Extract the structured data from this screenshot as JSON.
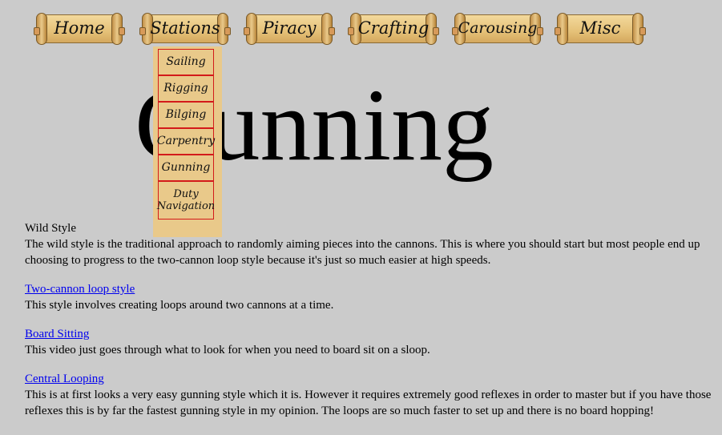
{
  "nav": {
    "tabs": [
      {
        "label": "Home"
      },
      {
        "label": "Stations"
      },
      {
        "label": "Piracy"
      },
      {
        "label": "Crafting"
      },
      {
        "label": "Carousing"
      },
      {
        "label": "Misc"
      }
    ],
    "dropdown": [
      {
        "label": "Sailing"
      },
      {
        "label": "Rigging"
      },
      {
        "label": "Bilging"
      },
      {
        "label": "Carpentry"
      },
      {
        "label": "Gunning"
      },
      {
        "label": "Duty Navigation"
      }
    ]
  },
  "page": {
    "title": "Gunning"
  },
  "sections": [
    {
      "heading": "Wild Style",
      "text": "The wild style is the traditional approach to randomly aiming pieces into the cannons. This is where you should start but most people end up choosing to progress to the two-cannon loop style because it's just so much easier at high speeds."
    },
    {
      "heading": "Two-cannon loop style",
      "text": "This style involves creating loops around two cannons at a time."
    },
    {
      "heading": "Board Sitting",
      "text": "This video just goes through what to look for when you need to board sit on a sloop."
    },
    {
      "heading": "Central Looping",
      "text": "This is at first looks a very easy gunning style which it is. However it requires extremely good reflexes in order to master but if you have those reflexes this is by far the fastest gunning style in my opinion. The loops are so much faster to set up and there is no board hopping!"
    }
  ],
  "colors": {
    "background": "#cbcbcb",
    "scroll": "#e5c178",
    "dropdown_border": "#d31a1a",
    "link": "#0000ee"
  }
}
